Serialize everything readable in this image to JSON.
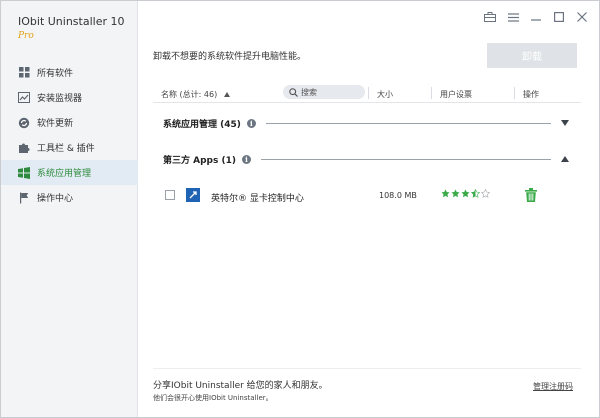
{
  "app": {
    "title": "IObit Uninstaller 10",
    "edition": "Pro"
  },
  "sidebar": {
    "items": [
      {
        "label": "所有软件",
        "icon": "grid-icon",
        "active": false
      },
      {
        "label": "安装监视器",
        "icon": "chart-icon",
        "active": false
      },
      {
        "label": "软件更新",
        "icon": "refresh-icon",
        "active": false
      },
      {
        "label": "工具栏 & 插件",
        "icon": "puzzle-icon",
        "active": false
      },
      {
        "label": "系统应用管理",
        "icon": "windows-icon",
        "active": true
      },
      {
        "label": "操作中心",
        "icon": "flag-icon",
        "active": false
      }
    ]
  },
  "main": {
    "subtitle": "卸载不想要的系统软件提升电脑性能。",
    "uninstall_label": "卸载",
    "columns": {
      "name": "名称 (总计: 46)",
      "search_placeholder": "搜索",
      "size": "大小",
      "rating": "用户设票",
      "action": "操作"
    },
    "groups": [
      {
        "title": "系统应用管理 (45)",
        "expanded": false
      },
      {
        "title": "第三方 Apps (1)",
        "expanded": true
      }
    ],
    "rows": [
      {
        "name": "英特尔® 显卡控制中心",
        "size": "108.0 MB",
        "rating": 3.5
      }
    ]
  },
  "footer": {
    "share_text": "分享IObit Uninstaller 给您的家人和朋友。",
    "sub_text": "他们会很开心使用IObit Uninstaller。",
    "register_label": "管理注册码"
  },
  "colors": {
    "accent_green": "#2e8b3e",
    "star_green": "#3bab4a",
    "sidebar_bg": "#f3f4f6",
    "button_disabled": "#dfe2e6"
  }
}
